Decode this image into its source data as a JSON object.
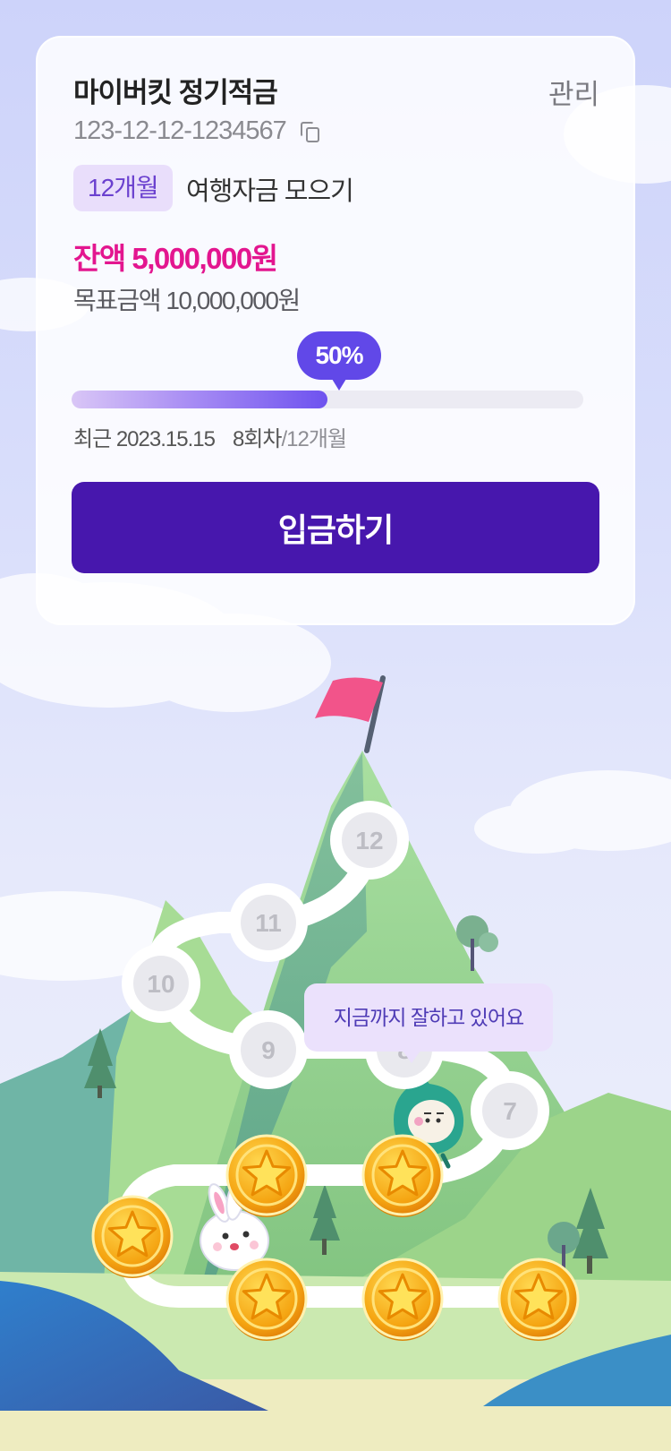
{
  "colors": {
    "accent": "#4717ad",
    "balance": "#e3168f",
    "progress": "#6148e8",
    "badge_bg": "#e9defb"
  },
  "account": {
    "title": "마이버킷 정기적금",
    "manage_label": "관리",
    "number": "123-12-12-1234567",
    "copy_icon": "copy-icon",
    "term_badge": "12개월",
    "purpose": "여행자금 모으기",
    "balance": "잔액 5,000,000원",
    "goal": "목표금액 10,000,000원"
  },
  "progress": {
    "percent_label": "50%",
    "percent": 50,
    "recent": "최근 2023.15.15",
    "count": "8회차",
    "total": "/12개월"
  },
  "deposit_button": "입금하기",
  "journey": {
    "cheer_message": "지금까지 잘하고 있어요",
    "completed_steps": 6,
    "current_step": 8,
    "pending_steps": [
      "7",
      "8",
      "9",
      "10",
      "11",
      "12"
    ]
  }
}
